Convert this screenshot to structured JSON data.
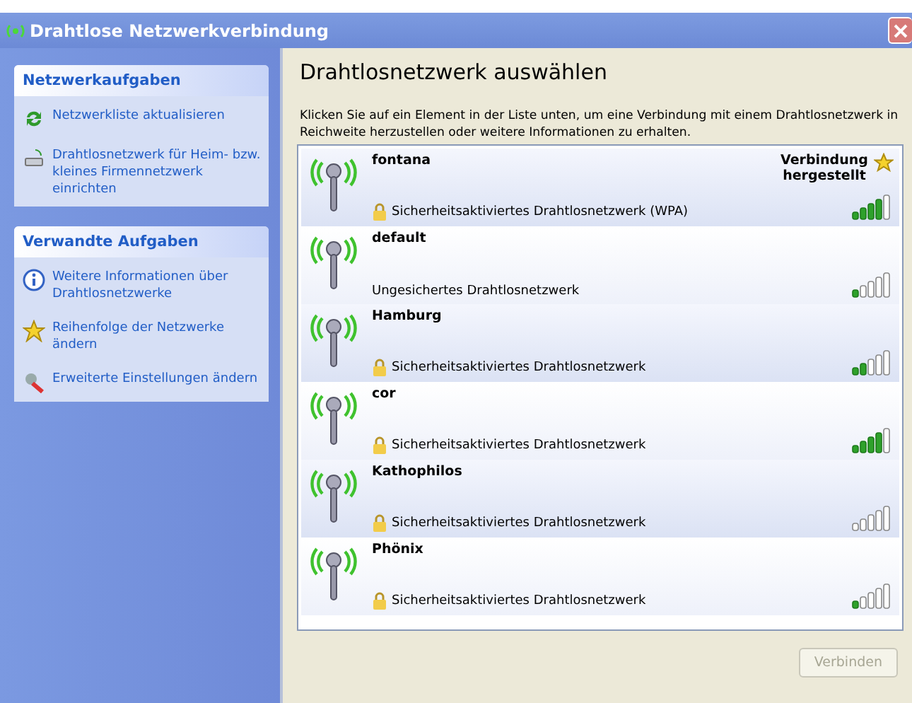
{
  "window": {
    "title": "Drahtlose Netzwerkverbindung"
  },
  "task_panels": [
    {
      "title": "Netzwerkaufgaben",
      "items": [
        {
          "label": "Netzwerkliste aktualisieren"
        },
        {
          "label": "Drahtlosnetzwerk für Heim- bzw. kleines Firmennetzwerk einrichten"
        }
      ]
    },
    {
      "title": "Verwandte Aufgaben",
      "items": [
        {
          "label": "Weitere Informationen über Drahtlosnetzwerke"
        },
        {
          "label": "Reihenfolge der Netzwerke ändern"
        },
        {
          "label": "Erweiterte Einstellungen ändern"
        }
      ]
    }
  ],
  "heading": "Drahtlosnetzwerk auswählen",
  "description": "Klicken Sie auf ein Element in der Liste unten, um eine Verbindung mit einem Drahtlosnetzwerk in Reichweite herzustellen oder weitere Informationen zu erhalten.",
  "networks": [
    {
      "name": "fontana",
      "secured": true,
      "security": "Sicherheitsaktiviertes Drahtlosnetzwerk (WPA)",
      "status": "Verbindung hergestellt",
      "connected": true
    },
    {
      "name": "default",
      "secured": false,
      "security": "Ungesichertes Drahtlosnetzwerk",
      "connected": false
    },
    {
      "name": "Hamburg",
      "secured": true,
      "security": "Sicherheitsaktiviertes Drahtlosnetzwerk",
      "connected": false
    },
    {
      "name": "cor",
      "secured": true,
      "security": "Sicherheitsaktiviertes Drahtlosnetzwerk",
      "connected": false
    },
    {
      "name": "Kathophilos",
      "secured": true,
      "security": "Sicherheitsaktiviertes Drahtlosnetzwerk",
      "connected": false
    },
    {
      "name": "Phönix",
      "secured": true,
      "security": "Sicherheitsaktiviertes Drahtlosnetzwerk",
      "connected": false
    }
  ],
  "connect_button": {
    "label": "Verbinden",
    "disabled": true
  }
}
